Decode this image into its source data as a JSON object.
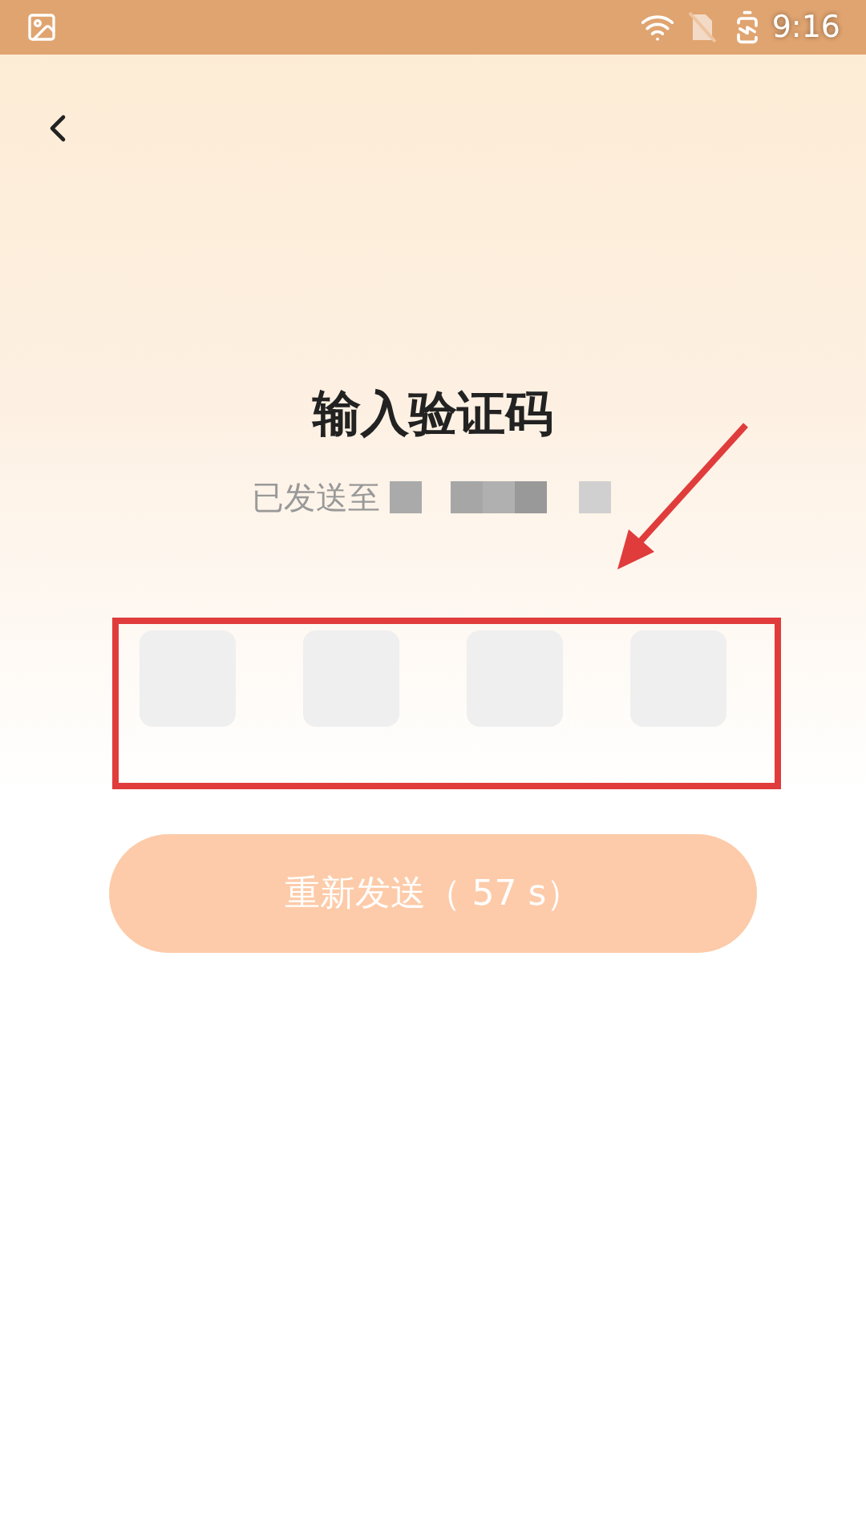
{
  "status_bar": {
    "time": "9:16"
  },
  "title": "输入验证码",
  "subtitle": "已发送至",
  "code_boxes": [
    {
      "filled": false
    },
    {
      "filled": false
    },
    {
      "filled": false
    },
    {
      "filled": false
    }
  ],
  "resend_button": {
    "label": "重新发送（ 57 s）",
    "disabled": true
  }
}
